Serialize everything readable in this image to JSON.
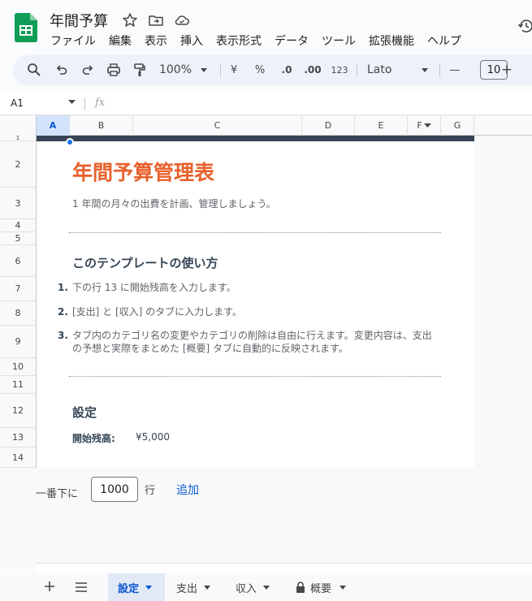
{
  "doc": {
    "title": "年間予算"
  },
  "menu": [
    "ファイル",
    "編集",
    "表示",
    "挿入",
    "表示形式",
    "データ",
    "ツール",
    "拡張機能",
    "ヘルプ"
  ],
  "toolbar": {
    "zoom": "100%",
    "currency": "¥",
    "percent": "%",
    "decrease_decimal": ".0",
    "increase_decimal": ".00",
    "number_format": "123",
    "font": "Lato",
    "font_size": "10",
    "minus": "—",
    "plus": "+"
  },
  "formula_bar": {
    "cell_ref": "A1",
    "fx": "fx"
  },
  "columns": [
    "A",
    "B",
    "C",
    "D",
    "E",
    "F",
    "G"
  ],
  "rows": [
    "1",
    "2",
    "3",
    "4",
    "5",
    "6",
    "7",
    "8",
    "9",
    "10",
    "11",
    "12",
    "13",
    "14"
  ],
  "sheet": {
    "title": "年間予算管理表",
    "subtitle": "1 年間の月々の出費を計画、管理しましょう。",
    "howto_title": "このテンプレートの使い方",
    "steps": [
      {
        "num": "1.",
        "text": "下の行 13 に開始残高を入力します。"
      },
      {
        "num": "2.",
        "text": "[支出] と [収入] のタブに入力します。"
      },
      {
        "num": "3.",
        "text": "タブ内のカテゴリ名の変更やカテゴリの削除は自由に行えます。変更内容は、支出の予想と実際をまとめた [概要] タブに自動的に反映されます。"
      }
    ],
    "settings_title": "設定",
    "balance_label": "開始残高:",
    "balance_value": "¥5,000"
  },
  "add_rows": {
    "label": "一番下に",
    "count": "1000",
    "unit": "行",
    "button": "追加"
  },
  "tabs": [
    {
      "label": "設定",
      "active": true
    },
    {
      "label": "支出",
      "active": false
    },
    {
      "label": "収入",
      "active": false
    },
    {
      "label": "概要",
      "active": false,
      "locked": true
    }
  ],
  "colors": {
    "accent_orange": "#e8612c",
    "header_band": "#364555",
    "selection_blue": "#1a73e8",
    "active_tab": "#0b57d0"
  }
}
